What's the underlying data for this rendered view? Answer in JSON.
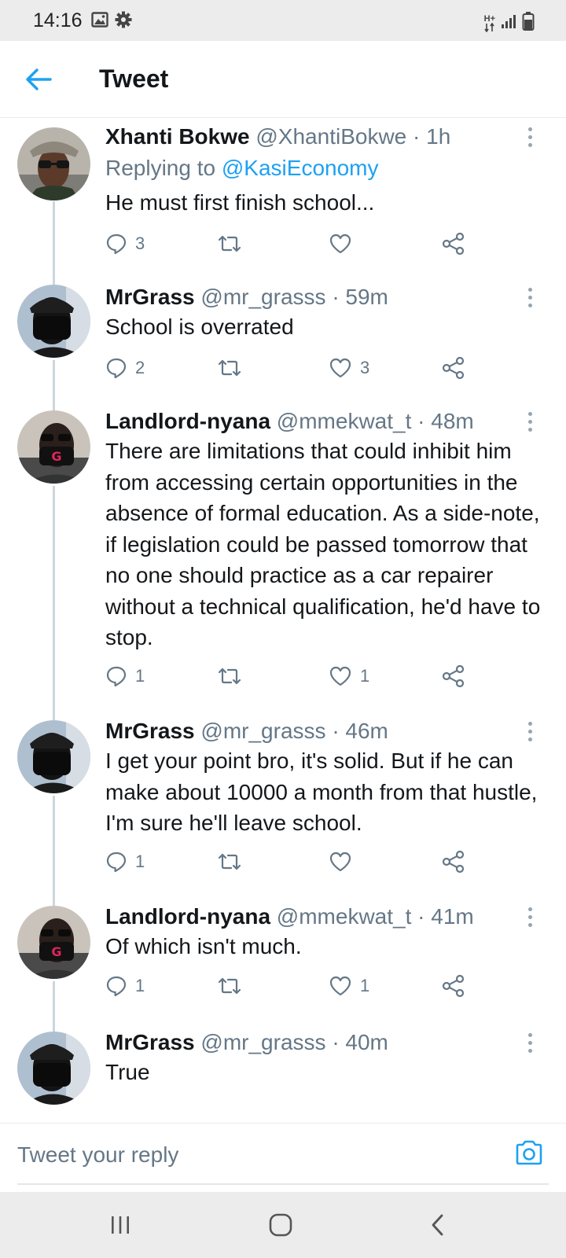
{
  "status_bar": {
    "time": "14:16",
    "icons": [
      "image-icon",
      "gear-icon"
    ],
    "right_icons": [
      "data-arrows-icon",
      "signal-icon",
      "battery-icon"
    ],
    "network_label": "H+"
  },
  "header": {
    "title": "Tweet",
    "accent_color": "#1da1f2"
  },
  "tweets": [
    {
      "name": "Xhanti Bokwe",
      "handle": "@XhantiBokwe",
      "time": "· 1h",
      "replying_label": "Replying to",
      "replying_handle": "@KasiEconomy",
      "text": "He must first finish school...",
      "replies": "3",
      "retweets": "",
      "likes": ""
    },
    {
      "name": "MrGrass",
      "handle": "@mr_grasss",
      "time": "· 59m",
      "text": "School is overrated",
      "replies": "2",
      "retweets": "",
      "likes": "3"
    },
    {
      "name": "Landlord-nyana",
      "handle": "@mmekwat_t",
      "time": "· 48m",
      "text": "There are limitations that could inhibit him from accessing certain opportunities in the absence of formal education. As a side-note, if legislation could be passed tomorrow that no one should practice as a car repairer without a technical qualification, he'd have to stop.",
      "replies": "1",
      "retweets": "",
      "likes": "1"
    },
    {
      "name": "MrGrass",
      "handle": "@mr_grasss",
      "time": "· 46m",
      "text": "I get your point bro, it's solid. But if he can make about 10000 a month from that hustle, I'm sure he'll leave school.",
      "replies": "1",
      "retweets": "",
      "likes": ""
    },
    {
      "name": "Landlord-nyana",
      "handle": "@mmekwat_t",
      "time": "· 41m",
      "text": "Of which isn't much.",
      "replies": "1",
      "retweets": "",
      "likes": "1"
    },
    {
      "name": "MrGrass",
      "handle": "@mr_grasss",
      "time": "· 40m",
      "text": "True",
      "replies": "",
      "retweets": "",
      "likes": ""
    }
  ],
  "reply_box": {
    "placeholder": "Tweet your reply",
    "camera_icon": "camera-icon"
  },
  "nav_bar": {
    "buttons": [
      "recent-apps-icon",
      "home-icon",
      "back-icon"
    ]
  }
}
